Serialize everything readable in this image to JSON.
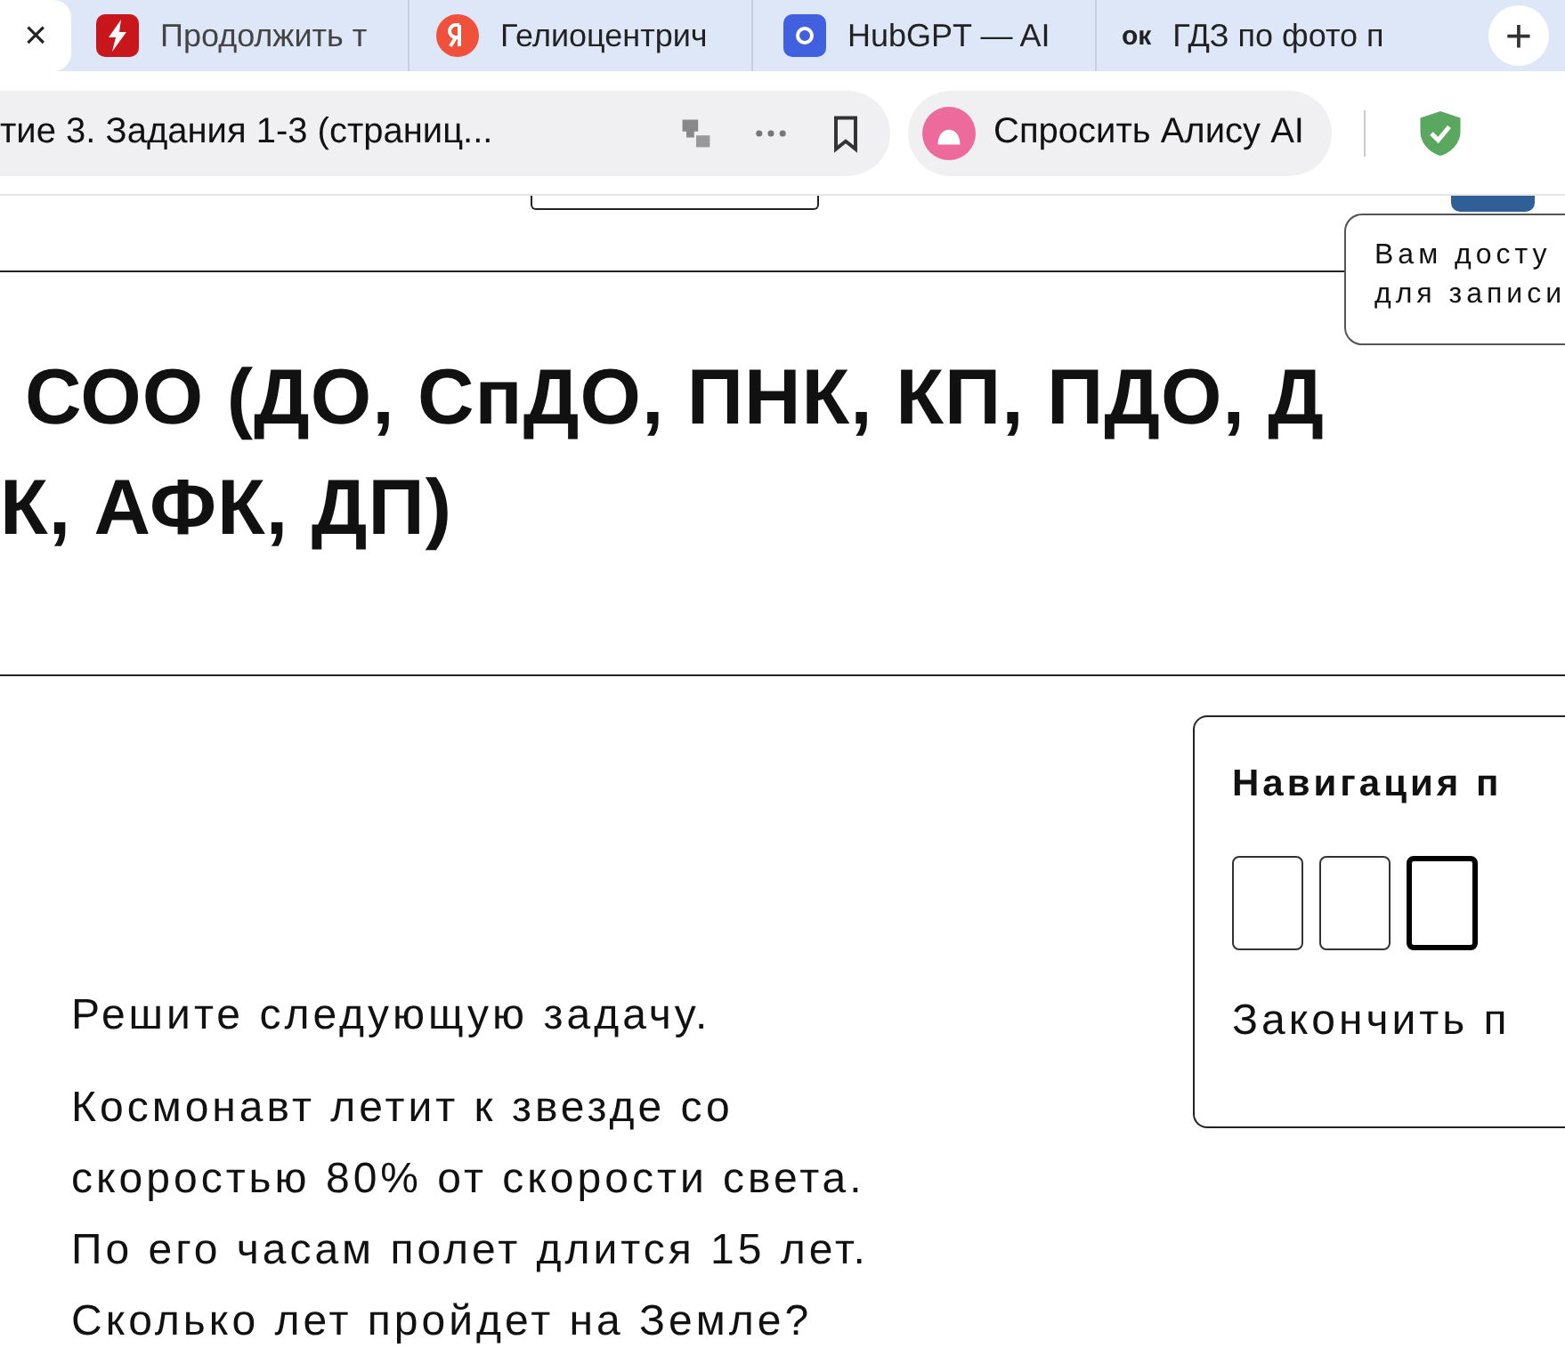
{
  "browser": {
    "tabs": [
      {
        "kind": "close",
        "label": "×",
        "selected": true
      },
      {
        "kind": "pdf",
        "label": "Продолжить т",
        "selected": false
      },
      {
        "kind": "yandex",
        "label": "Гелиоцентрич",
        "selected": false
      },
      {
        "kind": "hub",
        "label": "HubGPT — AI",
        "selected": false
      },
      {
        "kind": "ok",
        "label": "ГДЗ по фото п",
        "icon_text": "ок",
        "selected": false
      }
    ],
    "new_tab": "+",
    "address": "тие 3. Задания 1-3 (страниц...",
    "alice_button": "Спросить Алису AI"
  },
  "tooltip": [
    "Вам досту",
    "для записи"
  ],
  "heading": [
    "СОО (ДО, СпДО, ПНК, КП, ПДО, Д",
    "К, АФК, ДП)"
  ],
  "question": {
    "intro": "Решите следующую задачу.",
    "lines": [
      "Космонавт летит к звезде со",
      "скоростью 80% от скорости света.",
      "По его часам полет длится 15 лет.",
      "Сколько лет пройдет на Земле?"
    ]
  },
  "navigation": {
    "title": "Навигация п",
    "items": [
      {
        "selected": false
      },
      {
        "selected": false
      },
      {
        "selected": true
      }
    ],
    "finish_link": "Закончить п"
  }
}
